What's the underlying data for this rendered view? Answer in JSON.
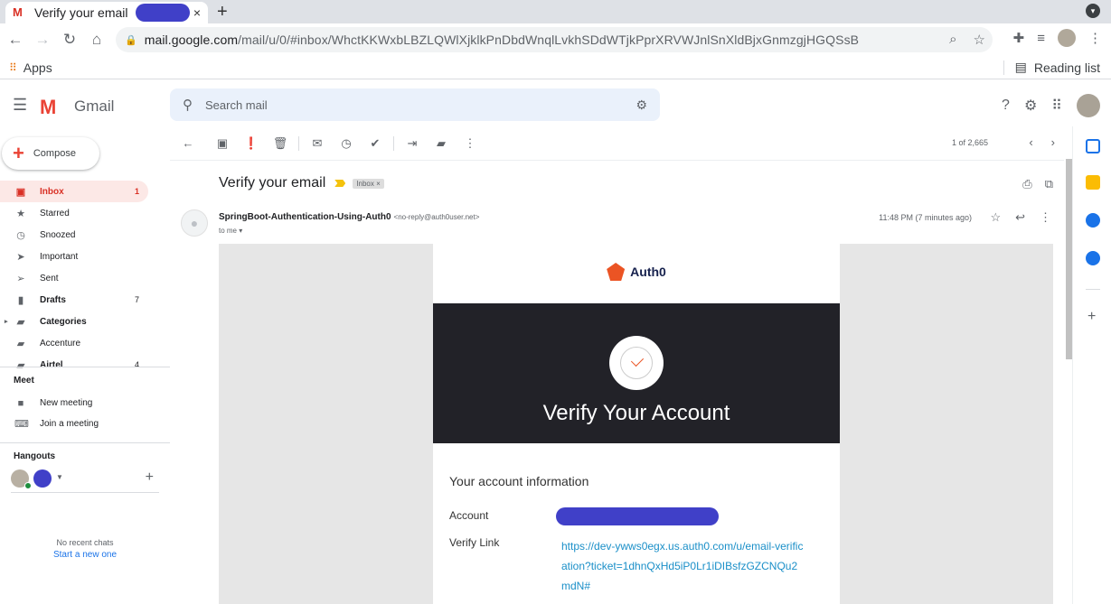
{
  "browser": {
    "tab_title": "Verify your email",
    "tab_close": "×",
    "new_tab": "+",
    "url_host": "mail.google.com",
    "url_path": "/mail/u/0/#inbox/WhctKKWxbLBZLQWlXjklkPnDbdWnqlLvkhSDdWTjkPprXRVWJnlSnXldBjxGnmzgjHGQSsB",
    "bookmarks_apps": "Apps",
    "reading_list": "Reading list"
  },
  "gmail": {
    "product_name": "Gmail",
    "search_placeholder": "Search mail",
    "compose_label": "Compose",
    "nav": [
      {
        "label": "Inbox",
        "count": "1"
      },
      {
        "label": "Starred",
        "count": ""
      },
      {
        "label": "Snoozed",
        "count": ""
      },
      {
        "label": "Important",
        "count": ""
      },
      {
        "label": "Sent",
        "count": ""
      },
      {
        "label": "Drafts",
        "count": "7"
      },
      {
        "label": "Categories",
        "count": ""
      },
      {
        "label": "Accenture",
        "count": ""
      },
      {
        "label": "Airtel",
        "count": "4"
      }
    ],
    "meet": {
      "title": "Meet",
      "new_meeting": "New meeting",
      "join_meeting": "Join a meeting"
    },
    "hangouts": {
      "title": "Hangouts",
      "no_chats": "No recent chats",
      "start_new": "Start a new one"
    },
    "pager": "1 of 2,665"
  },
  "message": {
    "subject": "Verify your email",
    "label": "Inbox",
    "label_remove": "×",
    "sender_name": "SpringBoot-Authentication-Using-Auth0",
    "sender_email": "<no-reply@auth0user.net>",
    "to": "to me",
    "time": "11:48 PM (7 minutes ago)"
  },
  "email_content": {
    "brand": "Auth0",
    "heading": "Verify Your Account",
    "section_title": "Your account information",
    "account_label": "Account",
    "verify_label": "Verify Link",
    "verify_url": "https://dev-ywws0egx.us.auth0.com/u/email-verification?ticket=1dhnQxHd5iP0Lr1iDIBsfzGZCNQu2mdN#"
  },
  "colors": {
    "gmail_red": "#d93025",
    "inbox_active_bg": "#fce8e6",
    "link_blue": "#1a73e8",
    "auth0_orange": "#eb5424",
    "redaction": "#4040c8"
  }
}
